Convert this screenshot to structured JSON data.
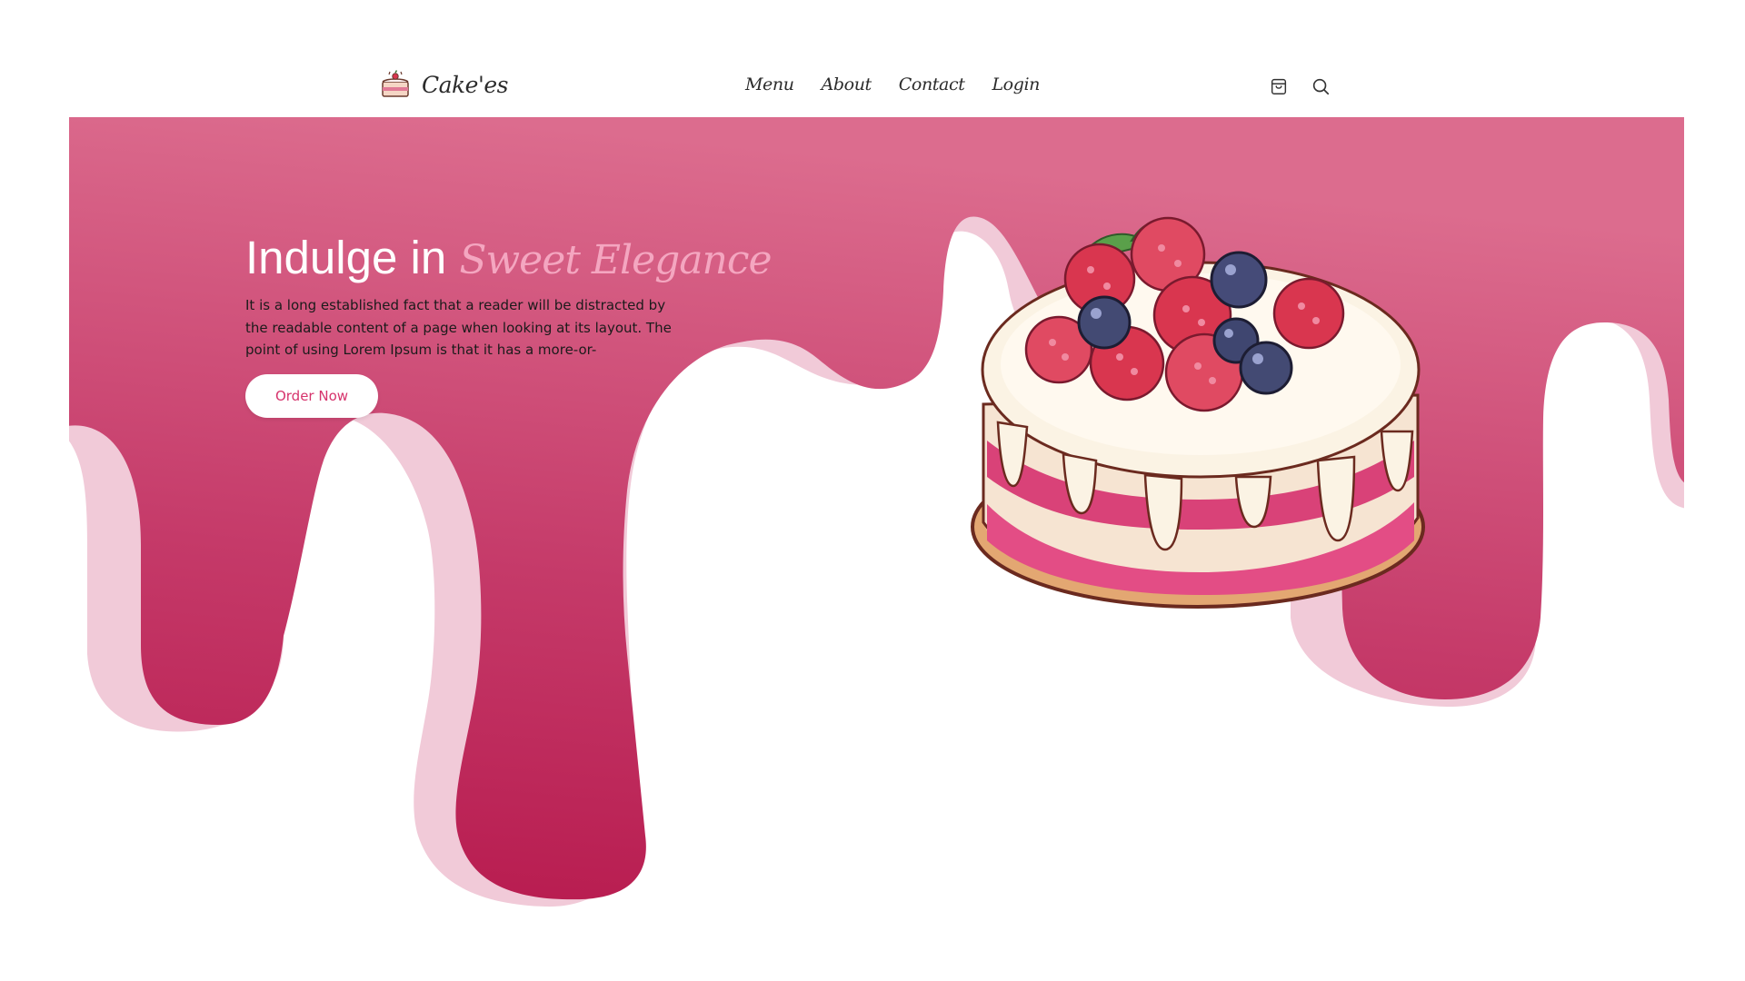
{
  "brand": {
    "name": "Cake'es",
    "logo_icon": "cake-slice-icon"
  },
  "nav": {
    "items": [
      {
        "label": "Menu"
      },
      {
        "label": "About"
      },
      {
        "label": "Contact"
      },
      {
        "label": "Login"
      }
    ],
    "icons": [
      "shopping-bag-icon",
      "search-icon"
    ]
  },
  "hero": {
    "title_prefix": "Indulge in ",
    "title_accent": "Sweet Elegance",
    "description": "It is a long established fact that a reader will be distracted by the readable content of a page when looking at its layout. The point of using Lorem Ipsum is that it has a more-or-",
    "cta_label": "Order Now",
    "image_icon": "raspberry-cake-illustration"
  },
  "colors": {
    "hero_top": "#dc6c8e",
    "hero_bottom": "#b71a4e",
    "drip_shadow": "#f1cad8",
    "accent_text": "#f4a6c0",
    "button_text": "#d6336c",
    "nav_text": "#2b2b2b"
  }
}
